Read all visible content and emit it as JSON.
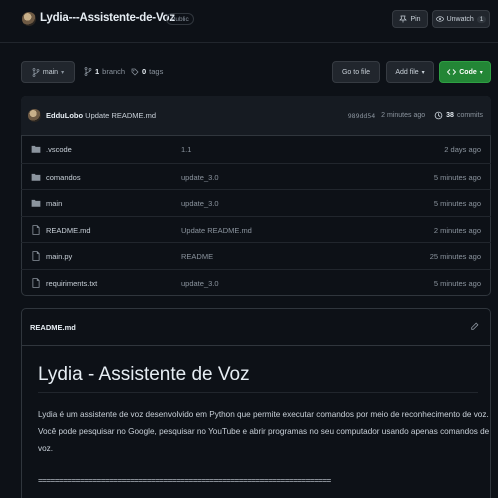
{
  "repo": {
    "name": "Lydia---Assistente-de-Voz",
    "visibility": "Public",
    "pin_label": "Pin",
    "watch_label": "Unwatch",
    "watch_count": "1"
  },
  "toolbar": {
    "branch": "main",
    "branches_count": "1",
    "branches_label": "branch",
    "tags_count": "0",
    "tags_label": "tags",
    "go_to_file": "Go to file",
    "add_file": "Add file",
    "code": "Code"
  },
  "commit": {
    "author": "EdduLobo",
    "message": "Update README.md",
    "hash": "989dd54",
    "time": "2 minutes ago",
    "commits_count": "38",
    "commits_label": "commits"
  },
  "files": [
    {
      "name": ".vscode",
      "type": "folder",
      "message": "1.1",
      "time": "2 days ago"
    },
    {
      "name": "comandos",
      "type": "folder",
      "message": "update_3.0",
      "time": "5 minutes ago"
    },
    {
      "name": "main",
      "type": "folder",
      "message": "update_3.0",
      "time": "5 minutes ago"
    },
    {
      "name": "README.md",
      "type": "file",
      "message": "Update README.md",
      "time": "2 minutes ago"
    },
    {
      "name": "main.py",
      "type": "file",
      "message": "README",
      "time": "25 minutes ago"
    },
    {
      "name": "requiriments.txt",
      "type": "file",
      "message": "update_3.0",
      "time": "5 minutes ago"
    }
  ],
  "readme": {
    "filename": "README.md",
    "heading": "Lydia - Assistente de Voz",
    "paragraph": "Lydia é um assistente de voz desenvolvido em Python que permite executar comandos por meio de reconhecimento de voz. Você pode pesquisar no Google, pesquisar no YouTube e abrir programas no seu computador usando apenas comandos de voz.",
    "rule": "======================================================================"
  }
}
